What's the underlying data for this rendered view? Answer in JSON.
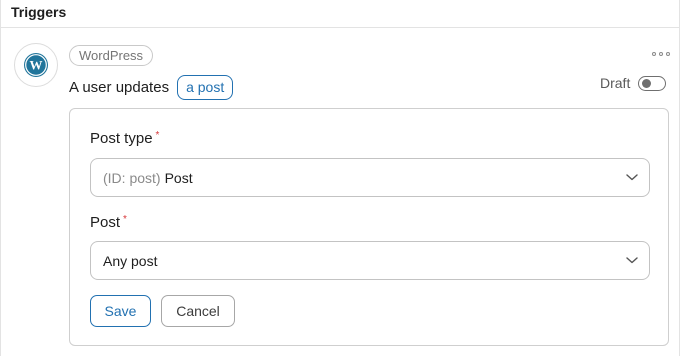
{
  "section": {
    "title": "Triggers"
  },
  "trigger": {
    "logo_icon": "wordpress-logo-icon",
    "source_label": "WordPress",
    "sentence_text": "A user updates",
    "token_label": "a post",
    "status_label": "Draft",
    "status_enabled": false,
    "more_icon": "more-horizontal-icon"
  },
  "form": {
    "post_type": {
      "label": "Post type",
      "required_mark": "*",
      "value_prefix": "(ID: post)",
      "value": "Post"
    },
    "post": {
      "label": "Post",
      "required_mark": "*",
      "value": "Any post"
    },
    "save_label": "Save",
    "cancel_label": "Cancel"
  },
  "colors": {
    "accent": "#2271b1",
    "required": "#d63638",
    "wordpress_brand": "#21759b"
  }
}
